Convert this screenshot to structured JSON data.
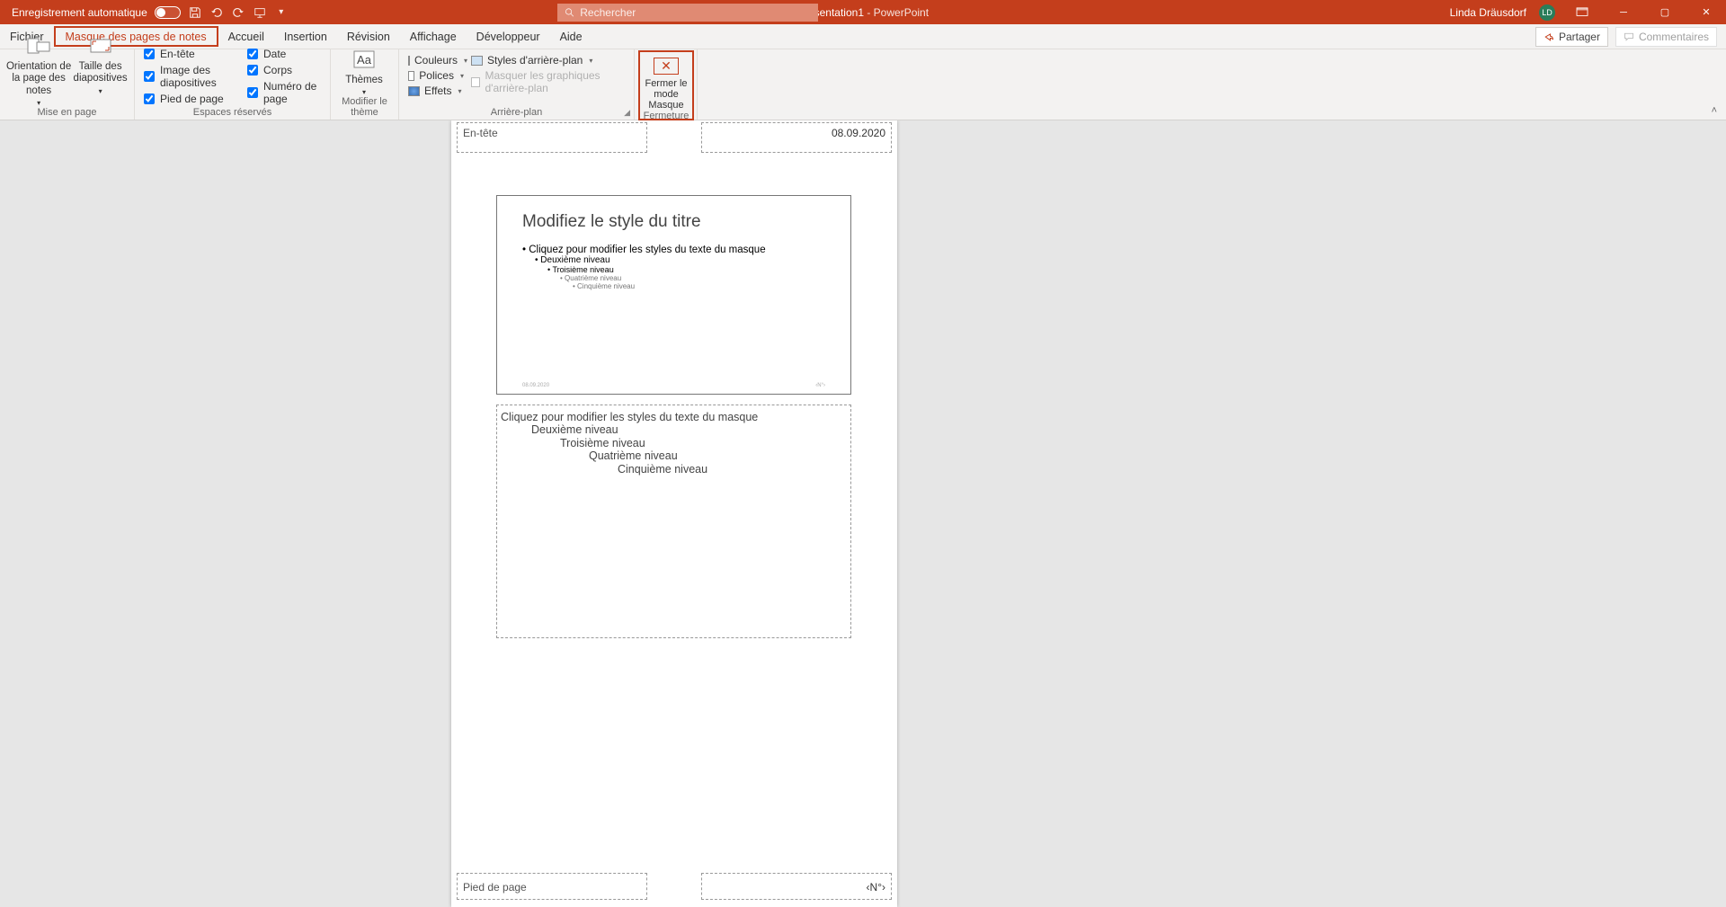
{
  "titlebar": {
    "autosave_label": "Enregistrement automatique",
    "doc_title": "Présentation1",
    "app_name": "PowerPoint",
    "separator": "  -  ",
    "search_placeholder": "Rechercher",
    "user_name": "Linda Dräusdorf",
    "user_initials": "LD"
  },
  "tabs": {
    "file": "Fichier",
    "notes_master": "Masque des pages de notes",
    "home": "Accueil",
    "insert": "Insertion",
    "review": "Révision",
    "view": "Affichage",
    "developer": "Développeur",
    "help": "Aide",
    "share": "Partager",
    "comments": "Commentaires"
  },
  "ribbon": {
    "page_setup": {
      "orientation": "Orientation de la page des notes",
      "slide_size": "Taille des diapositives",
      "group_label": "Mise en page"
    },
    "placeholders": {
      "header": "En-tête",
      "slide_image": "Image des diapositives",
      "footer": "Pied de page",
      "date": "Date",
      "body": "Corps",
      "page_number": "Numéro de page",
      "group_label": "Espaces réservés"
    },
    "theme": {
      "themes": "Thèmes",
      "group_label": "Modifier le thème"
    },
    "background": {
      "colors": "Couleurs",
      "fonts": "Polices",
      "effects": "Effets",
      "bg_styles": "Styles d'arrière-plan",
      "hide_bg": "Masquer les graphiques d'arrière-plan",
      "group_label": "Arrière-plan"
    },
    "close": {
      "close_master_line1": "Fermer le",
      "close_master_line2": "mode Masque",
      "group_label": "Fermeture"
    }
  },
  "page": {
    "header": "En-tête",
    "date": "08.09.2020",
    "slide_title": "Modifiez le style du titre",
    "bullet_levels": [
      "Cliquez pour modifier les styles du texte du masque",
      "Deuxième niveau",
      "Troisième niveau",
      "Quatrième niveau",
      "Cinquième niveau"
    ],
    "thumb_date": "08.09.2020",
    "thumb_num": "‹N°›",
    "notes_levels": [
      "Cliquez pour modifier les styles du texte du masque",
      "Deuxième niveau",
      "Troisième niveau",
      "Quatrième niveau",
      "Cinquième niveau"
    ],
    "footer": "Pied de page",
    "page_number": "‹N°›"
  }
}
